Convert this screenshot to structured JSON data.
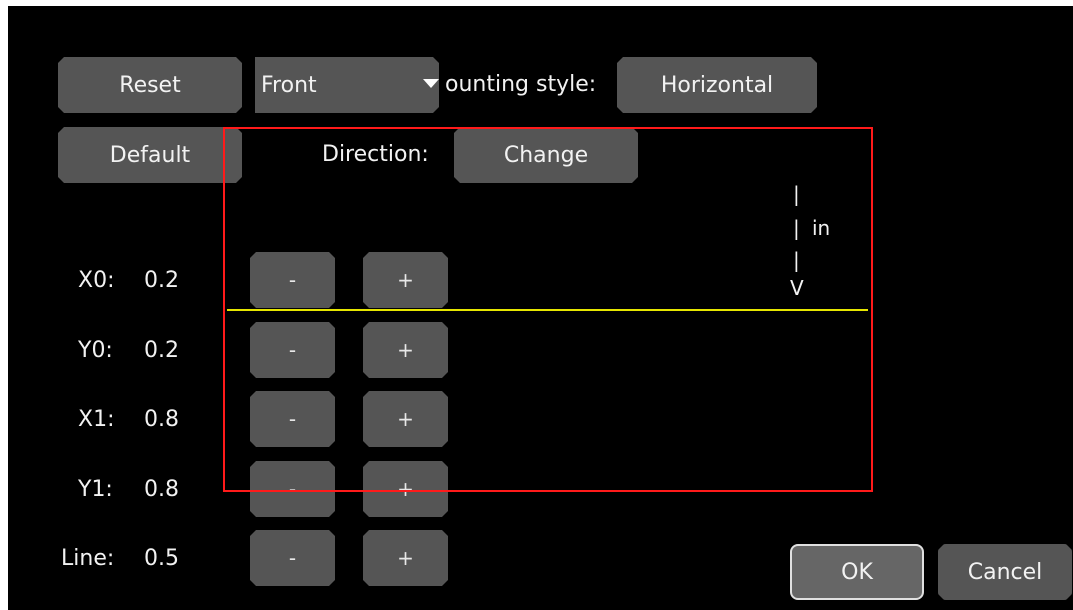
{
  "toolbar": {
    "reset_label": "Reset",
    "default_label": "Default",
    "view_select": "Front",
    "mounting_label": "ounting style:",
    "mounting_value": "Horizontal",
    "direction_label": "Direction:",
    "change_label": "Change"
  },
  "direction_indicator": {
    "bar1": "|",
    "bar2": "|",
    "text": "in",
    "bar3": "|",
    "head": "V"
  },
  "params": [
    {
      "name": "X0:",
      "value": "0.2",
      "minus": "-",
      "plus": "+"
    },
    {
      "name": "Y0:",
      "value": "0.2",
      "minus": "-",
      "plus": "+"
    },
    {
      "name": "X1:",
      "value": "0.8",
      "minus": "-",
      "plus": "+"
    },
    {
      "name": "Y1:",
      "value": "0.8",
      "minus": "-",
      "plus": "+"
    },
    {
      "name": "Line:",
      "value": "0.5",
      "minus": "-",
      "plus": "+"
    }
  ],
  "dialog": {
    "ok_label": "OK",
    "cancel_label": "Cancel"
  },
  "colors": {
    "background": "#000000",
    "button": "#555555",
    "region_box": "#ff1a1a",
    "detection_line": "#e6e600"
  }
}
